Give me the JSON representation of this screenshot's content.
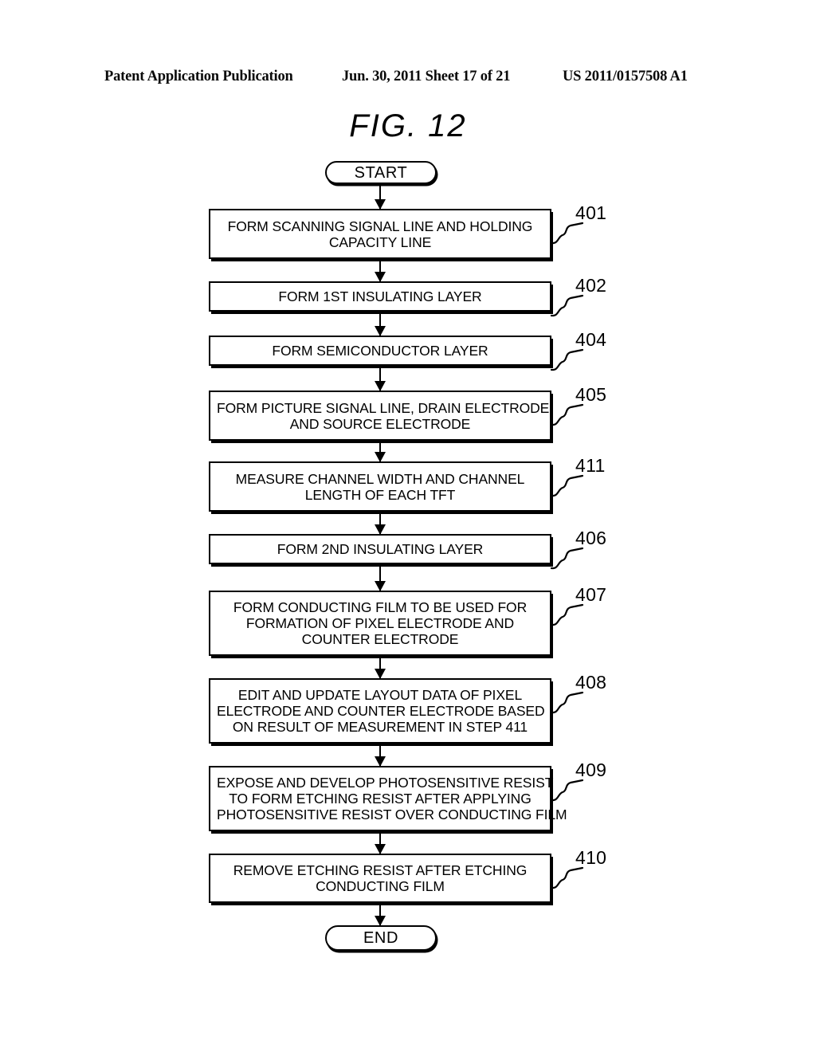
{
  "header": {
    "publication": "Patent Application Publication",
    "date_sheet": "Jun. 30, 2011  Sheet 17 of 21",
    "pub_number": "US 2011/0157508 A1"
  },
  "figure": {
    "title": "FIG.  12"
  },
  "flowchart": {
    "start_label": "START",
    "end_label": "END",
    "steps": [
      {
        "ref": "401",
        "lines": [
          "FORM SCANNING SIGNAL LINE AND HOLDING",
          "CAPACITY LINE"
        ]
      },
      {
        "ref": "402",
        "lines": [
          "FORM 1ST INSULATING LAYER"
        ]
      },
      {
        "ref": "404",
        "lines": [
          "FORM SEMICONDUCTOR LAYER"
        ]
      },
      {
        "ref": "405",
        "lines": [
          "FORM PICTURE SIGNAL LINE, DRAIN ELECTRODE,",
          "AND SOURCE ELECTRODE"
        ]
      },
      {
        "ref": "411",
        "lines": [
          "MEASURE CHANNEL WIDTH AND CHANNEL",
          "LENGTH OF EACH TFT"
        ]
      },
      {
        "ref": "406",
        "lines": [
          "FORM 2ND INSULATING LAYER"
        ]
      },
      {
        "ref": "407",
        "lines": [
          "FORM CONDUCTING FILM TO BE USED FOR",
          "FORMATION OF PIXEL ELECTRODE AND",
          "COUNTER ELECTRODE"
        ]
      },
      {
        "ref": "408",
        "lines": [
          "EDIT AND UPDATE LAYOUT DATA OF PIXEL",
          "ELECTRODE AND COUNTER ELECTRODE BASED",
          "ON RESULT OF MEASUREMENT IN STEP 411"
        ]
      },
      {
        "ref": "409",
        "lines": [
          "EXPOSE AND DEVELOP PHOTOSENSITIVE RESIST",
          "TO FORM ETCHING RESIST AFTER APPLYING",
          "PHOTOSENSITIVE RESIST OVER CONDUCTING FILM"
        ]
      },
      {
        "ref": "410",
        "lines": [
          "REMOVE ETCHING RESIST AFTER ETCHING",
          "CONDUCTING FILM"
        ]
      }
    ]
  },
  "colors": {
    "ink": "#000000",
    "paper": "#ffffff"
  }
}
